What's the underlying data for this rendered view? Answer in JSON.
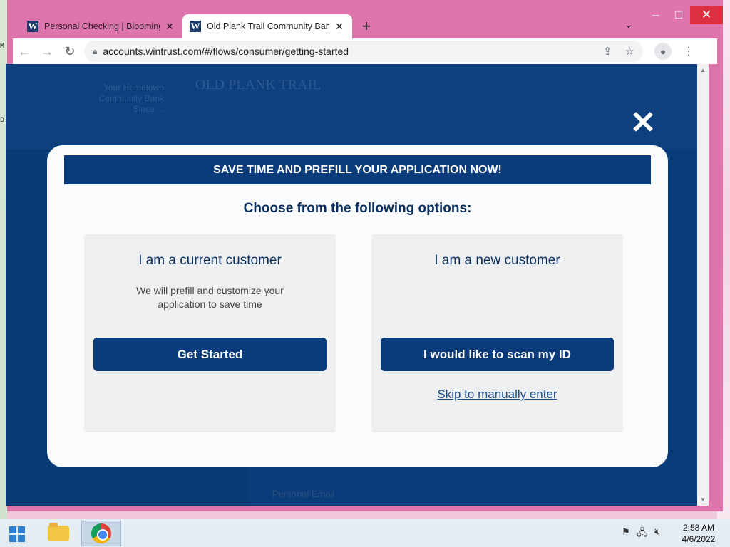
{
  "desktop": {
    "glyph_top": "M",
    "glyph_mid": "D"
  },
  "browser": {
    "tabs": [
      {
        "title": "Personal Checking | Bloomingdale",
        "favicon": "W",
        "active": false
      },
      {
        "title": "Old Plank Trail Community Bank",
        "favicon": "W",
        "active": true
      }
    ],
    "new_tab_label": "+",
    "url": "accounts.wintrust.com/#/flows/consumer/getting-started",
    "window_controls": {
      "minimize": "–",
      "maximize": "□",
      "close": "✕"
    }
  },
  "background_page": {
    "tagline": "Your Hometown Community Bank Since ...",
    "logo_text": "OLD PLANK TRAIL",
    "field_label": "Personal Email"
  },
  "modal": {
    "close_label": "✕",
    "banner": "SAVE TIME AND PREFILL YOUR APPLICATION NOW!",
    "subtitle": "Choose from the following options:",
    "current_customer": {
      "title": "I am a current customer",
      "description": "We will prefill and customize your application to save time",
      "button": "Get Started"
    },
    "new_customer": {
      "title": "I am a new customer",
      "button": "I would like to scan my ID",
      "link": "Skip to manually enter"
    }
  },
  "taskbar": {
    "time": "2:58 AM",
    "date": "4/6/2022",
    "tray_icons": [
      "flag-icon",
      "network-icon",
      "volume-muted-icon"
    ]
  },
  "colors": {
    "brand_navy": "#0a3c7c",
    "chrome_frame": "#dd74ab"
  }
}
